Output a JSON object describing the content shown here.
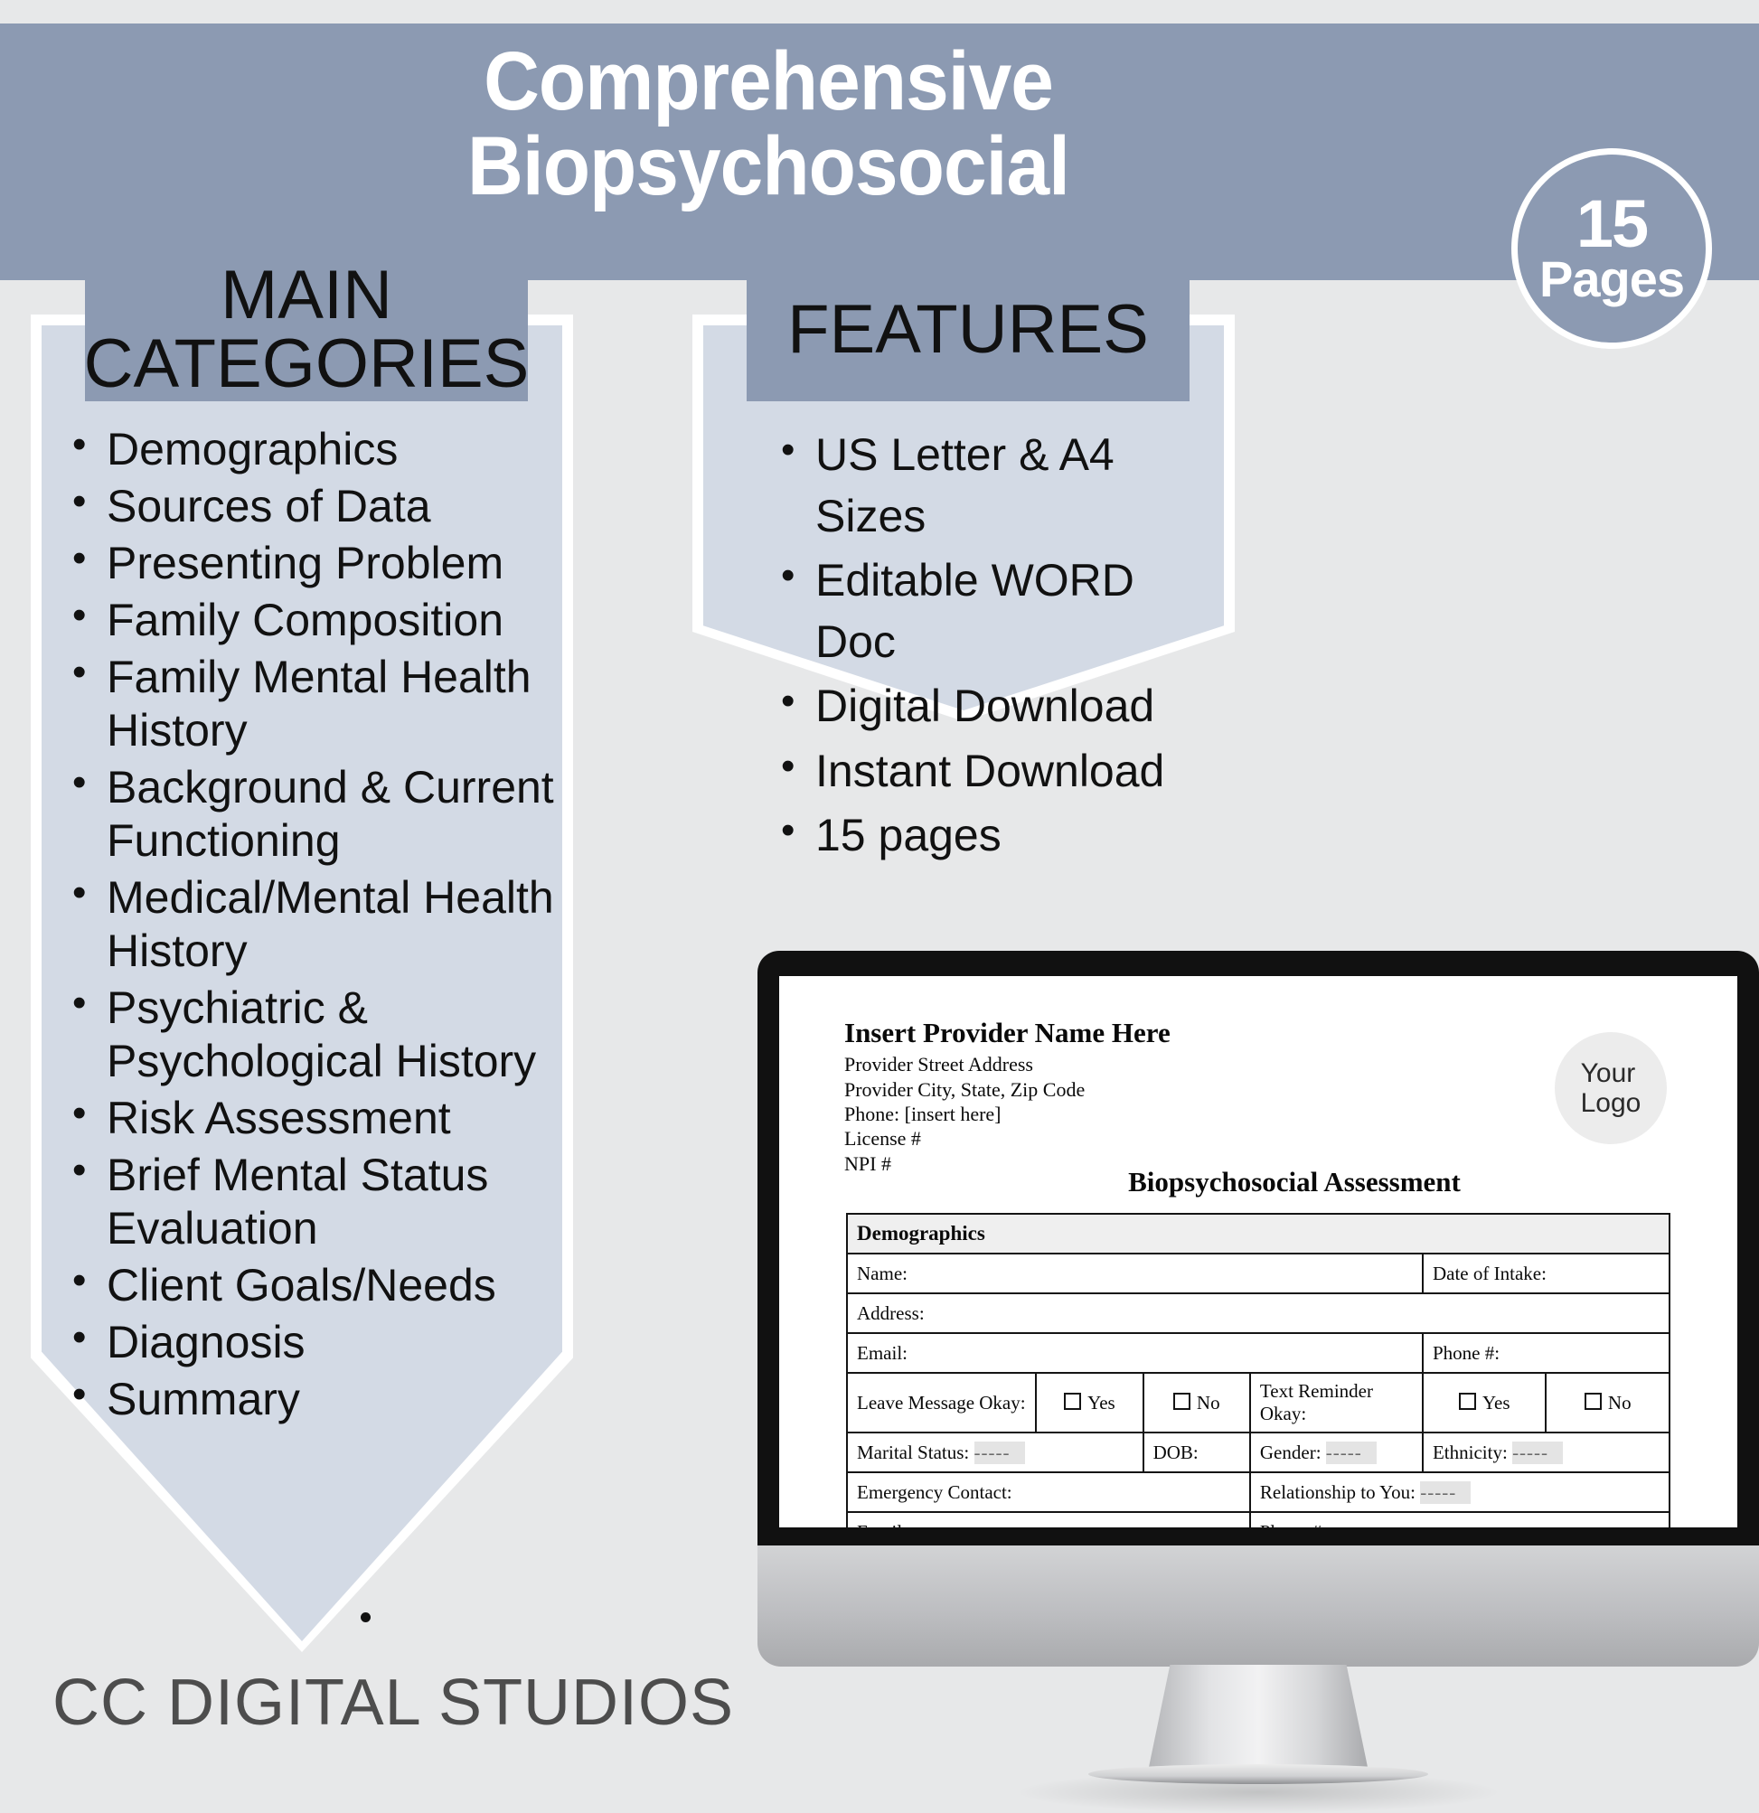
{
  "header": {
    "title": "Comprehensive\nBiopsychosocial",
    "banner_color": "#8c9ab2",
    "title_color": "#ffffff"
  },
  "pages_badge": {
    "count": "15",
    "label": "Pages"
  },
  "categories_panel": {
    "heading": "MAIN\nCATEGORIES",
    "items": [
      "Demographics",
      "Sources of Data",
      "Presenting Problem",
      "Family Composition",
      "Family Mental Health History",
      "Background & Current Functioning",
      "Medical/Mental Health History",
      "Psychiatric & Psychological History",
      "Risk Assessment",
      "Brief Mental Status Evaluation",
      "Client Goals/Needs",
      "Diagnosis",
      "Summary"
    ]
  },
  "features_panel": {
    "heading": "FEATURES",
    "items": [
      "US Letter & A4 Sizes",
      "Editable WORD Doc",
      "Digital Download",
      "Instant Download",
      "15 pages"
    ]
  },
  "brand": {
    "name": "CC DIGITAL STUDIOS"
  },
  "document_preview": {
    "provider_name": "Insert Provider Name Here",
    "provider_lines": [
      "Provider Street Address",
      "Provider City, State, Zip Code",
      "Phone: [insert here]",
      "License #",
      "NPI #"
    ],
    "logo_placeholder": "Your\nLogo",
    "doc_title": "Biopsychosocial Assessment",
    "section_header": "Demographics",
    "fields": {
      "name": "Name:",
      "date_of_intake": "Date of Intake:",
      "address": "Address:",
      "email": "Email:",
      "phone": "Phone #:",
      "leave_message": "Leave Message Okay:",
      "text_reminder": "Text Reminder Okay:",
      "yes": "Yes",
      "no": "No",
      "marital_status": "Marital Status:",
      "dob": "DOB:",
      "gender": "Gender:",
      "ethnicity": "Ethnicity:",
      "emergency_contact": "Emergency Contact:",
      "relationship": "Relationship to You:",
      "blank_value": "-----"
    }
  },
  "colors": {
    "page_background": "#e7e8e9",
    "accent_slate": "#8c9ab2",
    "panel_fill": "#d3dae5",
    "panel_border": "#ffffff",
    "text_dark": "#111111",
    "brand_text": "#4d4d4d"
  }
}
